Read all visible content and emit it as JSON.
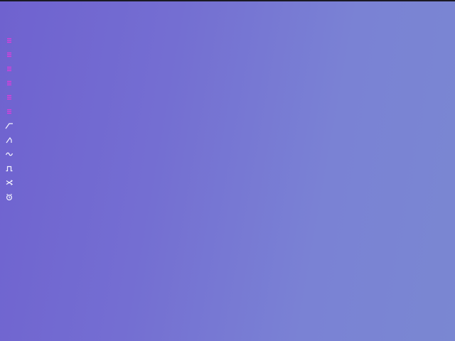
{
  "toolbar": {
    "items": [
      {
        "icon": "lines-icon",
        "color": "#e23bdc"
      },
      {
        "icon": "lines-icon",
        "color": "#e23bdc"
      },
      {
        "icon": "lines-icon",
        "color": "#e23bdc"
      },
      {
        "icon": "lines-icon",
        "color": "#e23bdc"
      },
      {
        "icon": "lines-icon",
        "color": "#e23bdc"
      },
      {
        "icon": "lines-icon",
        "color": "#e23bdc"
      },
      {
        "icon": "ramp-wave-icon",
        "color": "#f3f3ff"
      },
      {
        "icon": "sawtooth-wave-icon",
        "color": "#f3f3ff"
      },
      {
        "icon": "sine-wave-icon",
        "color": "#f3f3ff"
      },
      {
        "icon": "square-wave-icon",
        "color": "#f3f3ff"
      },
      {
        "icon": "shuffle-icon",
        "color": "#f3f3ff"
      },
      {
        "icon": "alarm-clock-icon",
        "color": "#f3f3ff"
      }
    ]
  }
}
